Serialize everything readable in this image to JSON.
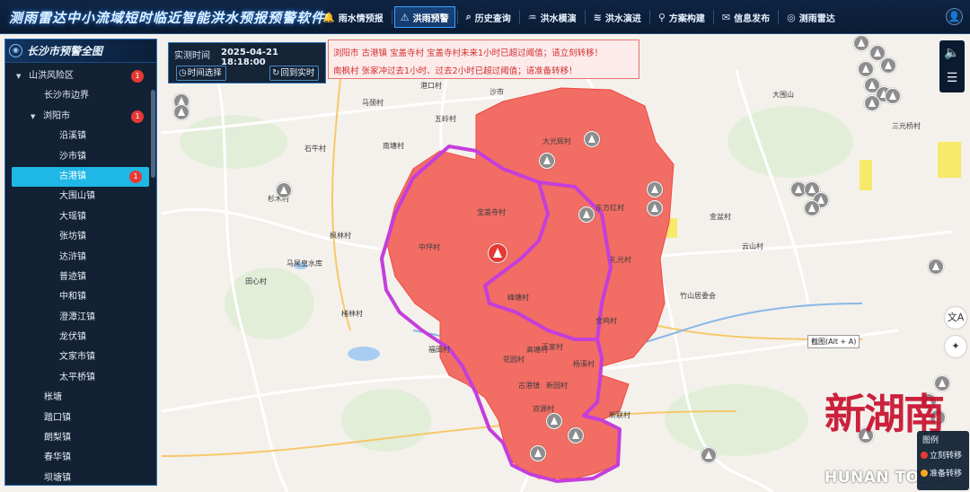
{
  "app": {
    "title": "测雨雷达中小流域短时临近智能洪水预报预警软件"
  },
  "nav": [
    {
      "label": "雨水情预报",
      "icon": "bell-icon",
      "active": false
    },
    {
      "label": "洪雨预警",
      "icon": "alert-triangle-icon",
      "active": true
    },
    {
      "label": "历史查询",
      "icon": "search-icon",
      "active": false
    },
    {
      "label": "洪水模演",
      "icon": "flood-icon",
      "active": false
    },
    {
      "label": "洪水演进",
      "icon": "wave-icon",
      "active": false
    },
    {
      "label": "方案构建",
      "icon": "pin-icon",
      "active": false
    },
    {
      "label": "信息发布",
      "icon": "message-icon",
      "active": false
    },
    {
      "label": "测雨雷达",
      "icon": "radar-icon",
      "active": false
    }
  ],
  "panel": {
    "title": "长沙市预警全图",
    "tree": [
      {
        "label": "山洪风险区",
        "level": 0,
        "expanded": true,
        "badge": "1"
      },
      {
        "label": "长沙市边界",
        "level": 1
      },
      {
        "label": "浏阳市",
        "level": 1,
        "expanded": true,
        "badge": "1"
      },
      {
        "label": "沿溪镇",
        "level": 2
      },
      {
        "label": "沙市镇",
        "level": 2
      },
      {
        "label": "古港镇",
        "level": 2,
        "selected": true,
        "badge": "1"
      },
      {
        "label": "大围山镇",
        "level": 2
      },
      {
        "label": "大瑶镇",
        "level": 2
      },
      {
        "label": "张坊镇",
        "level": 2
      },
      {
        "label": "达浒镇",
        "level": 2
      },
      {
        "label": "普迹镇",
        "level": 2
      },
      {
        "label": "中和镇",
        "level": 2
      },
      {
        "label": "澄潭江镇",
        "level": 2
      },
      {
        "label": "龙伏镇",
        "level": 2
      },
      {
        "label": "文家市镇",
        "level": 2
      },
      {
        "label": "太平桥镇",
        "level": 2
      },
      {
        "label": "枨塘",
        "level": 1
      },
      {
        "label": "踏口镇",
        "level": 1
      },
      {
        "label": "朗梨镇",
        "level": 1
      },
      {
        "label": "春华镇",
        "level": 1
      },
      {
        "label": "坝塘镇",
        "level": 1
      }
    ]
  },
  "time": {
    "label": "实测时间",
    "value": "2025-04-21 18:18:00",
    "select_button": "时间选择",
    "realtime_button": "回到实时"
  },
  "alerts": [
    "浏阳市 古港镇 宝盖寺村 宝盖寺村未来1小时已超过阈值；请立刻转移！",
    "南枫村 张家冲过去1小时、过去2小时已超过阈值；请准备转移！"
  ],
  "map": {
    "labels": [
      "宝盖寺村",
      "中坪村",
      "大光辉村",
      "古港镇",
      "东方红村",
      "杨溪村",
      "金鸡村",
      "王家村",
      "花园村",
      "高塘村",
      "新联村",
      "福田村",
      "石牛村",
      "南塘村",
      "双源村",
      "楮林村",
      "马尾皇水库",
      "田心村",
      "杉木村",
      "新园村",
      "港口村",
      "枫林村",
      "峰塘村",
      "礼元村",
      "沙市",
      "大围山",
      "三元桥村",
      "云山村",
      "竹山居委会",
      "金盆村",
      "五岭村",
      "马颈村"
    ],
    "capture_tip": "截图(Alt + A)"
  },
  "legend": {
    "title": "图例",
    "items": [
      {
        "label": "立刻转移",
        "color": "#e53935"
      },
      {
        "label": "准备转移",
        "color": "#f5a623"
      }
    ]
  },
  "watermark": {
    "cn": "新湖南",
    "en": "HUNAN TODAY"
  }
}
